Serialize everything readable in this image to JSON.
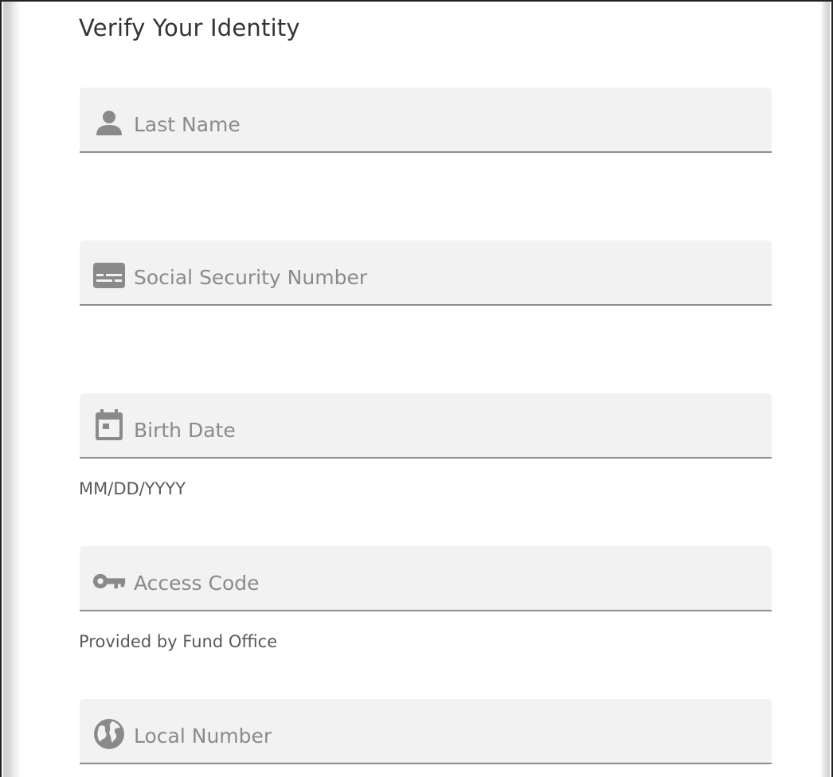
{
  "form": {
    "title": "Verify Your Identity",
    "fields": [
      {
        "id": "last_name",
        "placeholder": "Last Name",
        "value": "",
        "icon": "person-icon",
        "hint": ""
      },
      {
        "id": "ssn",
        "placeholder": "Social Security Number",
        "value": "",
        "icon": "id-card-icon",
        "hint": ""
      },
      {
        "id": "birth_date",
        "placeholder": "Birth Date",
        "value": "",
        "icon": "calendar-icon",
        "hint": "MM/DD/YYYY"
      },
      {
        "id": "access_code",
        "placeholder": "Access Code",
        "value": "",
        "icon": "key-icon",
        "hint": "Provided by Fund Office"
      },
      {
        "id": "local_number",
        "placeholder": "Local Number",
        "value": "",
        "icon": "globe-icon",
        "hint": ""
      }
    ]
  },
  "colors": {
    "field_background": "#f2f2f2",
    "field_underline": "#8e8e8e",
    "icon": "#8a8a8a",
    "title_text": "#333333"
  }
}
